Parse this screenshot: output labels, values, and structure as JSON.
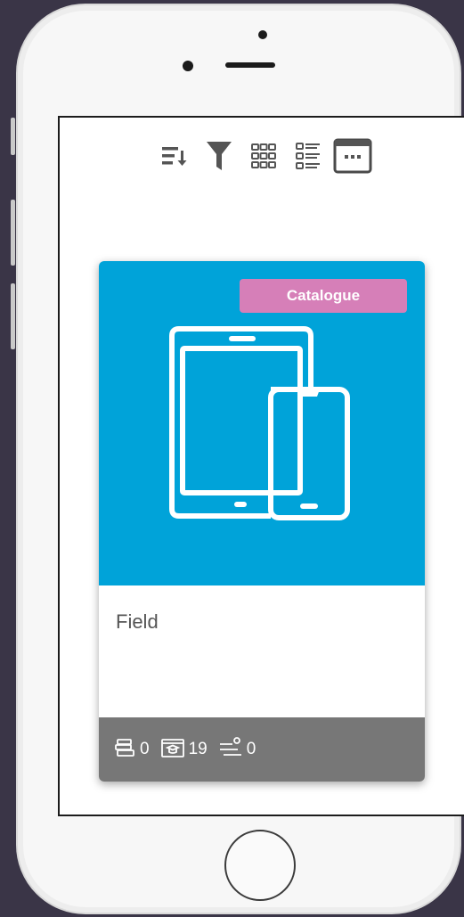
{
  "toolbar": {
    "buttons": [
      {
        "icon": "sort-icon"
      },
      {
        "icon": "filter-icon"
      },
      {
        "icon": "grid-view-icon"
      },
      {
        "icon": "list-view-icon"
      },
      {
        "icon": "calendar-view-icon",
        "selected": true
      }
    ]
  },
  "card": {
    "badge": "Catalogue",
    "title": "Field",
    "media_color": "#00a3d9",
    "badge_color": "#d67fb8",
    "footer_color": "#777777",
    "image_icon": "tablet-phone-icon",
    "stats": [
      {
        "icon": "courses-icon",
        "value": "0"
      },
      {
        "icon": "training-icon",
        "value": "19"
      },
      {
        "icon": "learning-path-icon",
        "value": "0"
      }
    ]
  }
}
